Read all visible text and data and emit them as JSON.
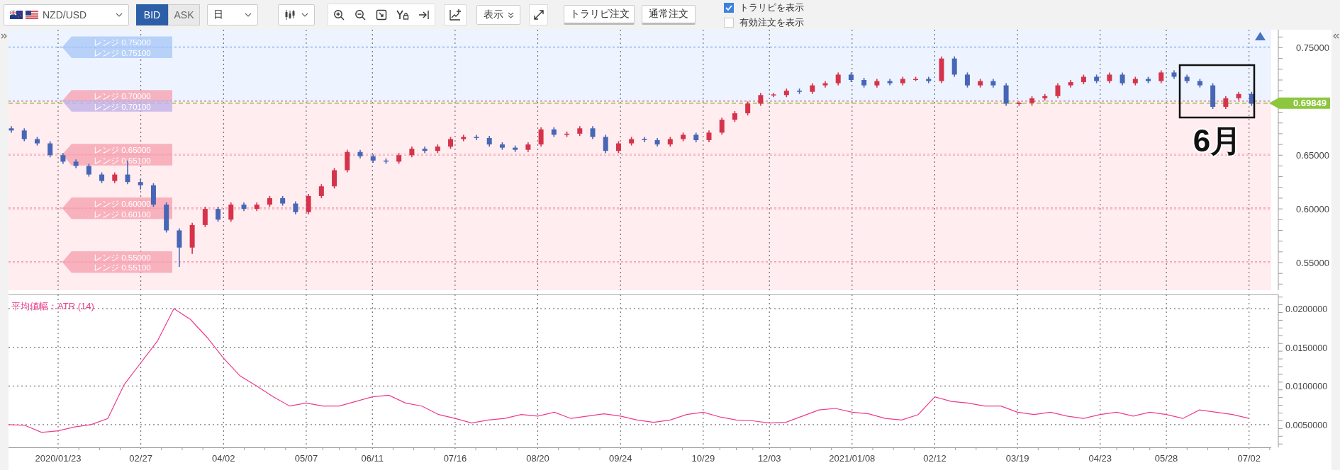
{
  "toolbar": {
    "symbol": "NZD/USD",
    "price_sides": [
      {
        "label": "BID",
        "selected": true
      },
      {
        "label": "ASK",
        "selected": false
      }
    ],
    "timeframe": "日",
    "display_menu": "表示",
    "buttons": [
      "トラリピ注文",
      "通常注文"
    ],
    "checkboxes": [
      {
        "label": "トラリピを表示",
        "checked": true
      },
      {
        "label": "有効注文を表示",
        "checked": false
      }
    ]
  },
  "price_chart": {
    "note": "6月",
    "chart_data": {
      "type": "candlestick",
      "grid": true,
      "categories": [
        null,
        null,
        null,
        null,
        null,
        null,
        null,
        null,
        null,
        null,
        null,
        null,
        null,
        null,
        null,
        null,
        null,
        null,
        null,
        null,
        null,
        null,
        null,
        null,
        null,
        null,
        null,
        null,
        null,
        null,
        null,
        null,
        null,
        null,
        null,
        null,
        null,
        null,
        null,
        null,
        null,
        null,
        null,
        null,
        null,
        null,
        null,
        null,
        null,
        null,
        null,
        null,
        null,
        null,
        null,
        null,
        null,
        null,
        null,
        null,
        null,
        null,
        null,
        null,
        null,
        null,
        null,
        null,
        null,
        null,
        null,
        null,
        null,
        null,
        null,
        null,
        null,
        null,
        null,
        null,
        null,
        null,
        null,
        null,
        null,
        null,
        null,
        null,
        null,
        null,
        null,
        null,
        null,
        null,
        null,
        null,
        null
      ],
      "ohlc": [
        [
          0.675,
          0.677,
          0.671,
          0.673
        ],
        [
          0.673,
          0.675,
          0.663,
          0.665
        ],
        [
          0.665,
          0.667,
          0.659,
          0.661
        ],
        [
          0.661,
          0.663,
          0.648,
          0.65
        ],
        [
          0.65,
          0.652,
          0.642,
          0.644
        ],
        [
          0.644,
          0.646,
          0.638,
          0.64
        ],
        [
          0.64,
          0.642,
          0.63,
          0.632
        ],
        [
          0.632,
          0.634,
          0.624,
          0.626
        ],
        [
          0.626,
          0.634,
          0.624,
          0.632
        ],
        [
          0.632,
          0.645,
          0.623,
          0.625
        ],
        [
          0.625,
          0.628,
          0.618,
          0.622
        ],
        [
          0.622,
          0.624,
          0.602,
          0.604
        ],
        [
          0.604,
          0.606,
          0.578,
          0.58
        ],
        [
          0.58,
          0.582,
          0.546,
          0.564
        ],
        [
          0.564,
          0.587,
          0.558,
          0.585
        ],
        [
          0.585,
          0.602,
          0.583,
          0.6
        ],
        [
          0.6,
          0.602,
          0.588,
          0.59
        ],
        [
          0.59,
          0.606,
          0.588,
          0.604
        ],
        [
          0.604,
          0.606,
          0.598,
          0.6
        ],
        [
          0.6,
          0.606,
          0.598,
          0.604
        ],
        [
          0.604,
          0.612,
          0.602,
          0.61
        ],
        [
          0.61,
          0.612,
          0.603,
          0.605
        ],
        [
          0.605,
          0.607,
          0.595,
          0.597
        ],
        [
          0.597,
          0.614,
          0.595,
          0.612
        ],
        [
          0.612,
          0.623,
          0.61,
          0.621
        ],
        [
          0.621,
          0.638,
          0.619,
          0.636
        ],
        [
          0.636,
          0.655,
          0.634,
          0.653
        ],
        [
          0.653,
          0.655,
          0.647,
          0.649
        ],
        [
          0.649,
          0.651,
          0.643,
          0.645
        ],
        [
          0.645,
          0.647,
          0.642,
          0.644
        ],
        [
          0.644,
          0.652,
          0.642,
          0.65
        ],
        [
          0.65,
          0.658,
          0.648,
          0.656
        ],
        [
          0.656,
          0.658,
          0.652,
          0.654
        ],
        [
          0.654,
          0.66,
          0.652,
          0.658
        ],
        [
          0.658,
          0.667,
          0.656,
          0.665
        ],
        [
          0.665,
          0.669,
          0.663,
          0.667
        ],
        [
          0.667,
          0.669,
          0.664,
          0.666
        ],
        [
          0.666,
          0.668,
          0.658,
          0.66
        ],
        [
          0.66,
          0.662,
          0.655,
          0.657
        ],
        [
          0.657,
          0.659,
          0.653,
          0.655
        ],
        [
          0.655,
          0.662,
          0.653,
          0.66
        ],
        [
          0.66,
          0.676,
          0.658,
          0.674
        ],
        [
          0.674,
          0.676,
          0.667,
          0.669
        ],
        [
          0.669,
          0.672,
          0.667,
          0.67
        ],
        [
          0.67,
          0.677,
          0.668,
          0.675
        ],
        [
          0.675,
          0.677,
          0.665,
          0.667
        ],
        [
          0.667,
          0.669,
          0.652,
          0.654
        ],
        [
          0.654,
          0.663,
          0.652,
          0.661
        ],
        [
          0.661,
          0.667,
          0.659,
          0.665
        ],
        [
          0.665,
          0.667,
          0.662,
          0.664
        ],
        [
          0.664,
          0.666,
          0.658,
          0.66
        ],
        [
          0.66,
          0.667,
          0.658,
          0.665
        ],
        [
          0.665,
          0.671,
          0.663,
          0.669
        ],
        [
          0.669,
          0.671,
          0.662,
          0.664
        ],
        [
          0.664,
          0.673,
          0.662,
          0.671
        ],
        [
          0.671,
          0.685,
          0.669,
          0.683
        ],
        [
          0.683,
          0.691,
          0.681,
          0.689
        ],
        [
          0.689,
          0.7,
          0.687,
          0.698
        ],
        [
          0.698,
          0.708,
          0.696,
          0.706
        ],
        [
          0.706,
          0.708,
          0.704,
          0.7066
        ],
        [
          0.706,
          0.712,
          0.704,
          0.71
        ],
        [
          0.71,
          0.712,
          0.707,
          0.709
        ],
        [
          0.709,
          0.717,
          0.707,
          0.715
        ],
        [
          0.715,
          0.719,
          0.713,
          0.717
        ],
        [
          0.717,
          0.727,
          0.715,
          0.725
        ],
        [
          0.725,
          0.727,
          0.718,
          0.72
        ],
        [
          0.72,
          0.722,
          0.713,
          0.715
        ],
        [
          0.715,
          0.721,
          0.713,
          0.719
        ],
        [
          0.719,
          0.721,
          0.715,
          0.717
        ],
        [
          0.717,
          0.723,
          0.715,
          0.721
        ],
        [
          0.721,
          0.723,
          0.719,
          0.721
        ],
        [
          0.721,
          0.723,
          0.717,
          0.719
        ],
        [
          0.719,
          0.742,
          0.717,
          0.74
        ],
        [
          0.74,
          0.742,
          0.723,
          0.725
        ],
        [
          0.725,
          0.727,
          0.713,
          0.715
        ],
        [
          0.715,
          0.721,
          0.713,
          0.719
        ],
        [
          0.719,
          0.721,
          0.713,
          0.715
        ],
        [
          0.715,
          0.717,
          0.696,
          0.698
        ],
        [
          0.698,
          0.7,
          0.696,
          0.6986
        ],
        [
          0.6986,
          0.705,
          0.696,
          0.703
        ],
        [
          0.703,
          0.707,
          0.701,
          0.705
        ],
        [
          0.705,
          0.717,
          0.703,
          0.715
        ],
        [
          0.715,
          0.72,
          0.713,
          0.718
        ],
        [
          0.718,
          0.725,
          0.716,
          0.723
        ],
        [
          0.723,
          0.725,
          0.717,
          0.719
        ],
        [
          0.719,
          0.727,
          0.717,
          0.725
        ],
        [
          0.725,
          0.727,
          0.715,
          0.717
        ],
        [
          0.717,
          0.723,
          0.715,
          0.721
        ],
        [
          0.721,
          0.723,
          0.717,
          0.719
        ],
        [
          0.719,
          0.729,
          0.717,
          0.727
        ],
        [
          0.727,
          0.729,
          0.721,
          0.723
        ],
        [
          0.723,
          0.725,
          0.717,
          0.719
        ],
        [
          0.719,
          0.721,
          0.713,
          0.715
        ],
        [
          0.715,
          0.717,
          0.693,
          0.695
        ],
        [
          0.695,
          0.705,
          0.693,
          0.703
        ],
        [
          0.703,
          0.709,
          0.701,
          0.707
        ],
        [
          0.707,
          0.709,
          0.696,
          0.698
        ]
      ],
      "ylim": [
        0.5243,
        0.7668
      ],
      "yticks": [
        {
          "value": 0.75,
          "label": "0.75000"
        },
        {
          "value": 0.65,
          "label": "0.65000"
        },
        {
          "value": 0.6,
          "label": "0.60000"
        },
        {
          "value": 0.55,
          "label": "0.55000"
        }
      ],
      "bands": [
        {
          "axis": "y",
          "from": 0.7,
          "to": 0.7668,
          "color": "#edf4ff"
        },
        {
          "axis": "y",
          "from": 0.5243,
          "to": 0.7,
          "color": "#ffedf0"
        }
      ],
      "ref_lines": [
        {
          "axis": "y",
          "value": 0.75,
          "label": "レンジ 0.75000",
          "color": "#a9c8f7"
        },
        {
          "axis": "y",
          "value": 0.751,
          "label": "レンジ 0.75100",
          "color": "#a9c8f7"
        },
        {
          "axis": "y",
          "value": 0.7,
          "label": "レンジ 0.70000",
          "color": "#f6a3b1"
        },
        {
          "axis": "y",
          "value": 0.701,
          "label": "レンジ 0.70100",
          "color": "#c2b2e8"
        },
        {
          "axis": "y",
          "value": 0.65,
          "label": "レンジ 0.65000",
          "color": "#f6a3b1"
        },
        {
          "axis": "y",
          "value": 0.651,
          "label": "レンジ 0.65100",
          "color": "#f6a3b1"
        },
        {
          "axis": "y",
          "value": 0.6,
          "label": "レンジ 0.60000",
          "color": "#f6a3b1"
        },
        {
          "axis": "y",
          "value": 0.601,
          "label": "レンジ 0.60100",
          "color": "#f6a3b1"
        },
        {
          "axis": "y",
          "value": 0.55,
          "label": "レンジ 0.55000",
          "color": "#f6a3b1"
        },
        {
          "axis": "y",
          "value": 0.551,
          "label": "レンジ 0.55100",
          "color": "#f6a3b1"
        },
        {
          "axis": "y",
          "value": 0.69849,
          "label": "0.69849",
          "color": "#8dc63f"
        }
      ]
    }
  },
  "indicator_chart": {
    "chart_data": {
      "type": "line",
      "title": "平均値幅：ATR (14)",
      "grid": true,
      "categories": [
        null,
        null,
        null,
        "2020/01/23",
        null,
        null,
        null,
        null,
        "02/27",
        null,
        null,
        null,
        null,
        "04/02",
        null,
        null,
        null,
        null,
        "05/07",
        null,
        null,
        null,
        "06/11",
        null,
        null,
        null,
        null,
        "07/16",
        null,
        null,
        null,
        null,
        "08/20",
        null,
        null,
        null,
        null,
        "09/24",
        null,
        null,
        null,
        null,
        "10/29",
        null,
        null,
        null,
        "12/03",
        null,
        null,
        null,
        null,
        "2021/01/08",
        null,
        null,
        null,
        null,
        "02/12",
        null,
        null,
        null,
        null,
        "03/19",
        null,
        null,
        null,
        null,
        "04/23",
        null,
        null,
        null,
        "05/28",
        null,
        null,
        null,
        null,
        "07/02"
      ],
      "series": [
        {
          "color": "#ee3a8c",
          "values": [
            0.005,
            0.0049,
            0.004,
            0.0042,
            0.0047,
            0.005,
            0.0058,
            0.0102,
            0.013,
            0.0158,
            0.02,
            0.0186,
            0.0163,
            0.0136,
            0.0113,
            0.01,
            0.0086,
            0.0074,
            0.0078,
            0.0074,
            0.0074,
            0.008,
            0.0086,
            0.0088,
            0.0078,
            0.0074,
            0.0063,
            0.0058,
            0.0052,
            0.0056,
            0.0058,
            0.0063,
            0.0061,
            0.0066,
            0.0058,
            0.0061,
            0.0064,
            0.0061,
            0.0056,
            0.0053,
            0.0056,
            0.0063,
            0.0066,
            0.006,
            0.0056,
            0.0055,
            0.0052,
            0.0053,
            0.0061,
            0.0069,
            0.0071,
            0.0066,
            0.0064,
            0.0058,
            0.0056,
            0.0063,
            0.0086,
            0.008,
            0.0078,
            0.0074,
            0.0074,
            0.0066,
            0.0063,
            0.0066,
            0.0061,
            0.0058,
            0.0063,
            0.0066,
            0.0061,
            0.0066,
            0.0063,
            0.0058,
            0.0069,
            0.0066,
            0.0063,
            0.0058
          ]
        }
      ],
      "ylim": [
        0.002064,
        0.021835
      ],
      "yticks": [
        {
          "value": 0.02,
          "label": "0.0200000"
        },
        {
          "value": 0.015,
          "label": "0.0150000"
        },
        {
          "value": 0.01,
          "label": "0.0100000"
        },
        {
          "value": 0.005,
          "label": "0.0050000"
        }
      ]
    }
  }
}
